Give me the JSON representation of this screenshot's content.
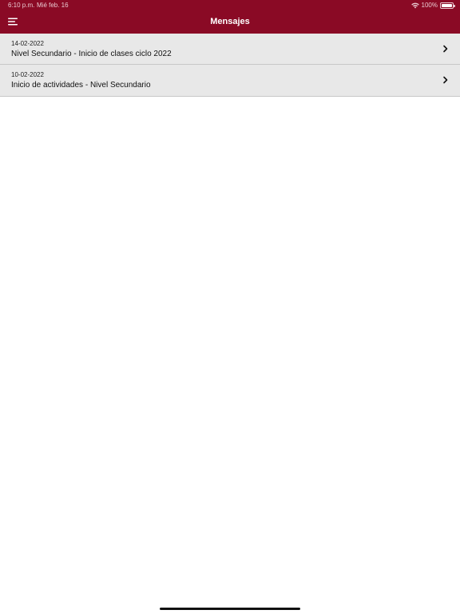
{
  "status_bar": {
    "time": "6:10 p.m.",
    "date": "Mié feb. 16",
    "battery": "100%",
    "wifi_icon": "wifi-icon",
    "battery_icon": "battery-icon",
    "text_color": "#e9c9d0"
  },
  "nav": {
    "title": "Mensajes",
    "menu_icon": "hamburger-menu-icon",
    "background": "#8a0a25"
  },
  "messages": [
    {
      "date": "14-02-2022",
      "title": "Nivel Secundario - Inicio de clases ciclo 2022",
      "icon": "chevron-right-icon"
    },
    {
      "date": "10-02-2022",
      "title": "Inicio de actividades - Nivel Secundario",
      "icon": "chevron-right-icon"
    }
  ],
  "colors": {
    "row_background": "#e8e8e8",
    "row_divider": "#c8c8c8",
    "page_background": "#ffffff"
  }
}
